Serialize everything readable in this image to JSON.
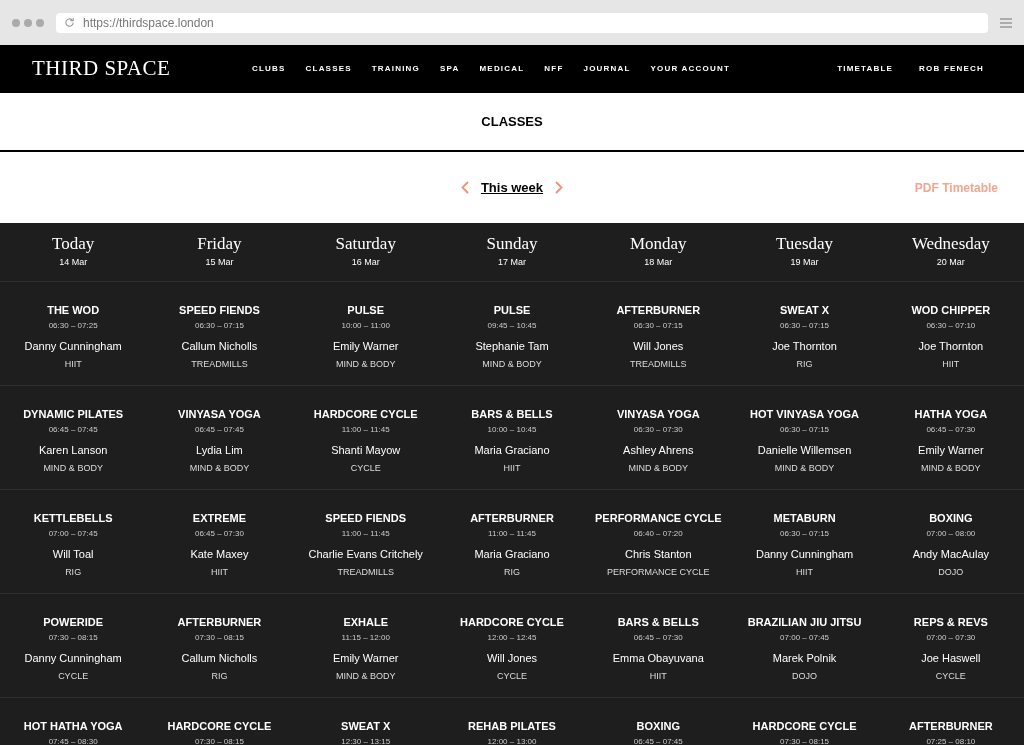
{
  "browser": {
    "url": "https://thirdspace.london"
  },
  "nav": {
    "logo": "THIRD SPACE",
    "links": [
      "CLUBS",
      "CLASSES",
      "TRAINING",
      "SPA",
      "MEDICAL",
      "NFF",
      "JOURNAL",
      "YOUR ACCOUNT"
    ],
    "right_links": [
      "TIMETABLE",
      "ROB FENECH"
    ]
  },
  "page_title": "CLASSES",
  "week_bar": {
    "label": "This week",
    "pdf_link": "PDF Timetable"
  },
  "days": [
    {
      "name": "Today",
      "date": "14 Mar"
    },
    {
      "name": "Friday",
      "date": "15 Mar"
    },
    {
      "name": "Saturday",
      "date": "16 Mar"
    },
    {
      "name": "Sunday",
      "date": "17 Mar"
    },
    {
      "name": "Monday",
      "date": "18 Mar"
    },
    {
      "name": "Tuesday",
      "date": "19 Mar"
    },
    {
      "name": "Wednesday",
      "date": "20 Mar"
    }
  ],
  "rows": [
    {
      "classes": [
        {
          "title": "THE WOD",
          "time": "06:30 – 07:25",
          "instructor": "Danny Cunningham",
          "category": "HIIT"
        },
        {
          "title": "SPEED FIENDS",
          "time": "06:30 – 07:15",
          "instructor": "Callum Nicholls",
          "category": "TREADMILLS"
        },
        {
          "title": "PULSE",
          "time": "10:00 – 11:00",
          "instructor": "Emily Warner",
          "category": "MIND & BODY"
        },
        {
          "title": "PULSE",
          "time": "09:45 – 10:45",
          "instructor": "Stephanie Tam",
          "category": "MIND & BODY"
        },
        {
          "title": "AFTERBURNER",
          "time": "06:30 – 07:15",
          "instructor": "Will Jones",
          "category": "TREADMILLS"
        },
        {
          "title": "SWEAT X",
          "time": "06:30 – 07:15",
          "instructor": "Joe Thornton",
          "category": "RIG"
        },
        {
          "title": "WOD CHIPPER",
          "time": "06:30 – 07:10",
          "instructor": "Joe Thornton",
          "category": "HIIT"
        }
      ]
    },
    {
      "classes": [
        {
          "title": "DYNAMIC PILATES",
          "time": "06:45 – 07:45",
          "instructor": "Karen Lanson",
          "category": "MIND & BODY"
        },
        {
          "title": "VINYASA YOGA",
          "time": "06:45 – 07:45",
          "instructor": "Lydia Lim",
          "category": "MIND & BODY"
        },
        {
          "title": "HARDCORE CYCLE",
          "time": "11:00 – 11:45",
          "instructor": "Shanti Mayow",
          "category": "CYCLE"
        },
        {
          "title": "BARS & BELLS",
          "time": "10:00 – 10:45",
          "instructor": "Maria Graciano",
          "category": "HIIT"
        },
        {
          "title": "VINYASA YOGA",
          "time": "06:30 – 07:30",
          "instructor": "Ashley Ahrens",
          "category": "MIND & BODY"
        },
        {
          "title": "HOT VINYASA YOGA",
          "time": "06:30 – 07:15",
          "instructor": "Danielle Willemsen",
          "category": "MIND & BODY"
        },
        {
          "title": "HATHA YOGA",
          "time": "06:45 – 07:30",
          "instructor": "Emily Warner",
          "category": "MIND & BODY"
        }
      ]
    },
    {
      "classes": [
        {
          "title": "KETTLEBELLS",
          "time": "07:00 – 07:45",
          "instructor": "Will Toal",
          "category": "RIG"
        },
        {
          "title": "EXTREME",
          "time": "06:45 – 07:30",
          "instructor": "Kate Maxey",
          "category": "HIIT"
        },
        {
          "title": "SPEED FIENDS",
          "time": "11:00 – 11:45",
          "instructor": "Charlie Evans Critchely",
          "category": "TREADMILLS"
        },
        {
          "title": "AFTERBURNER",
          "time": "11:00 – 11:45",
          "instructor": "Maria Graciano",
          "category": "RIG"
        },
        {
          "title": "PERFORMANCE CYCLE",
          "time": "06:40 – 07:20",
          "instructor": "Chris Stanton",
          "category": "PERFORMANCE CYCLE"
        },
        {
          "title": "METABURN",
          "time": "06:30 – 07:15",
          "instructor": "Danny Cunningham",
          "category": "HIIT"
        },
        {
          "title": "BOXING",
          "time": "07:00 – 08:00",
          "instructor": "Andy MacAulay",
          "category": "DOJO"
        }
      ]
    },
    {
      "classes": [
        {
          "title": "POWERIDE",
          "time": "07:30 – 08:15",
          "instructor": "Danny Cunningham",
          "category": "CYCLE"
        },
        {
          "title": "AFTERBURNER",
          "time": "07:30 – 08:15",
          "instructor": "Callum Nicholls",
          "category": "RIG"
        },
        {
          "title": "EXHALE",
          "time": "11:15 – 12:00",
          "instructor": "Emily Warner",
          "category": "MIND & BODY"
        },
        {
          "title": "HARDCORE CYCLE",
          "time": "12:00 – 12:45",
          "instructor": "Will Jones",
          "category": "CYCLE"
        },
        {
          "title": "BARS & BELLS",
          "time": "06:45 – 07:30",
          "instructor": "Emma Obayuvana",
          "category": "HIIT"
        },
        {
          "title": "BRAZILIAN JIU JITSU",
          "time": "07:00 – 07:45",
          "instructor": "Marek Polnik",
          "category": "DOJO"
        },
        {
          "title": "REPS & REVS",
          "time": "07:00 – 07:30",
          "instructor": "Joe Haswell",
          "category": "CYCLE"
        }
      ]
    },
    {
      "classes": [
        {
          "title": "HOT HATHA YOGA",
          "time": "07:45 – 08:30"
        },
        {
          "title": "HARDCORE CYCLE",
          "time": "07:30 – 08:15"
        },
        {
          "title": "SWEAT X",
          "time": "12:30 – 13:15"
        },
        {
          "title": "REHAB PILATES",
          "time": "12:00 – 13:00"
        },
        {
          "title": "BOXING",
          "time": "06:45 – 07:45"
        },
        {
          "title": "HARDCORE CYCLE",
          "time": "07:30 – 08:15"
        },
        {
          "title": "AFTERBURNER",
          "time": "07:25 – 08:10"
        }
      ]
    }
  ]
}
